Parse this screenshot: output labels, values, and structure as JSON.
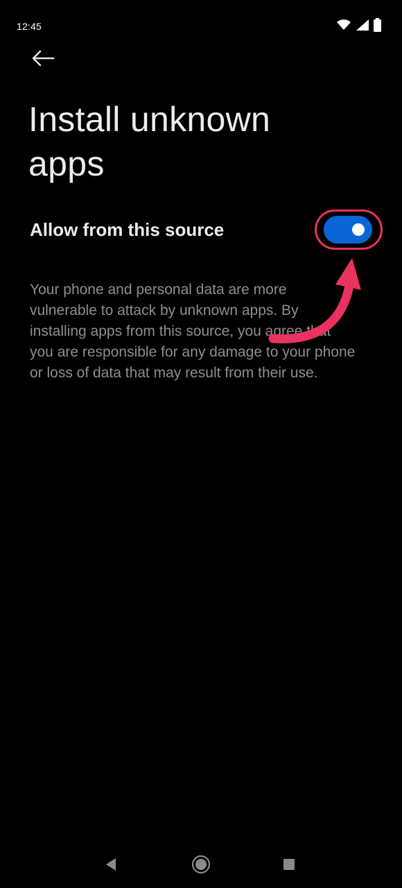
{
  "status_bar": {
    "time": "12:45",
    "icons": [
      "wifi-icon",
      "signal-icon",
      "battery-icon"
    ]
  },
  "header": {
    "back_icon": "arrow-left-icon",
    "title": "Install unknown apps"
  },
  "setting": {
    "label": "Allow from this source",
    "toggle_on": true,
    "toggle_color": "#0a66d6"
  },
  "description": "Your phone and personal data are more vulnerable to attack by unknown apps. By installing apps from this source, you agree that you are responsible for any damage to your phone or loss of data that may result from their use.",
  "annotation": {
    "highlight_color": "#e8335f",
    "arrow_icon": "curved-arrow-icon"
  },
  "nav_bar": {
    "buttons": [
      "back-triangle-icon",
      "home-circle-icon",
      "recents-square-icon"
    ]
  }
}
